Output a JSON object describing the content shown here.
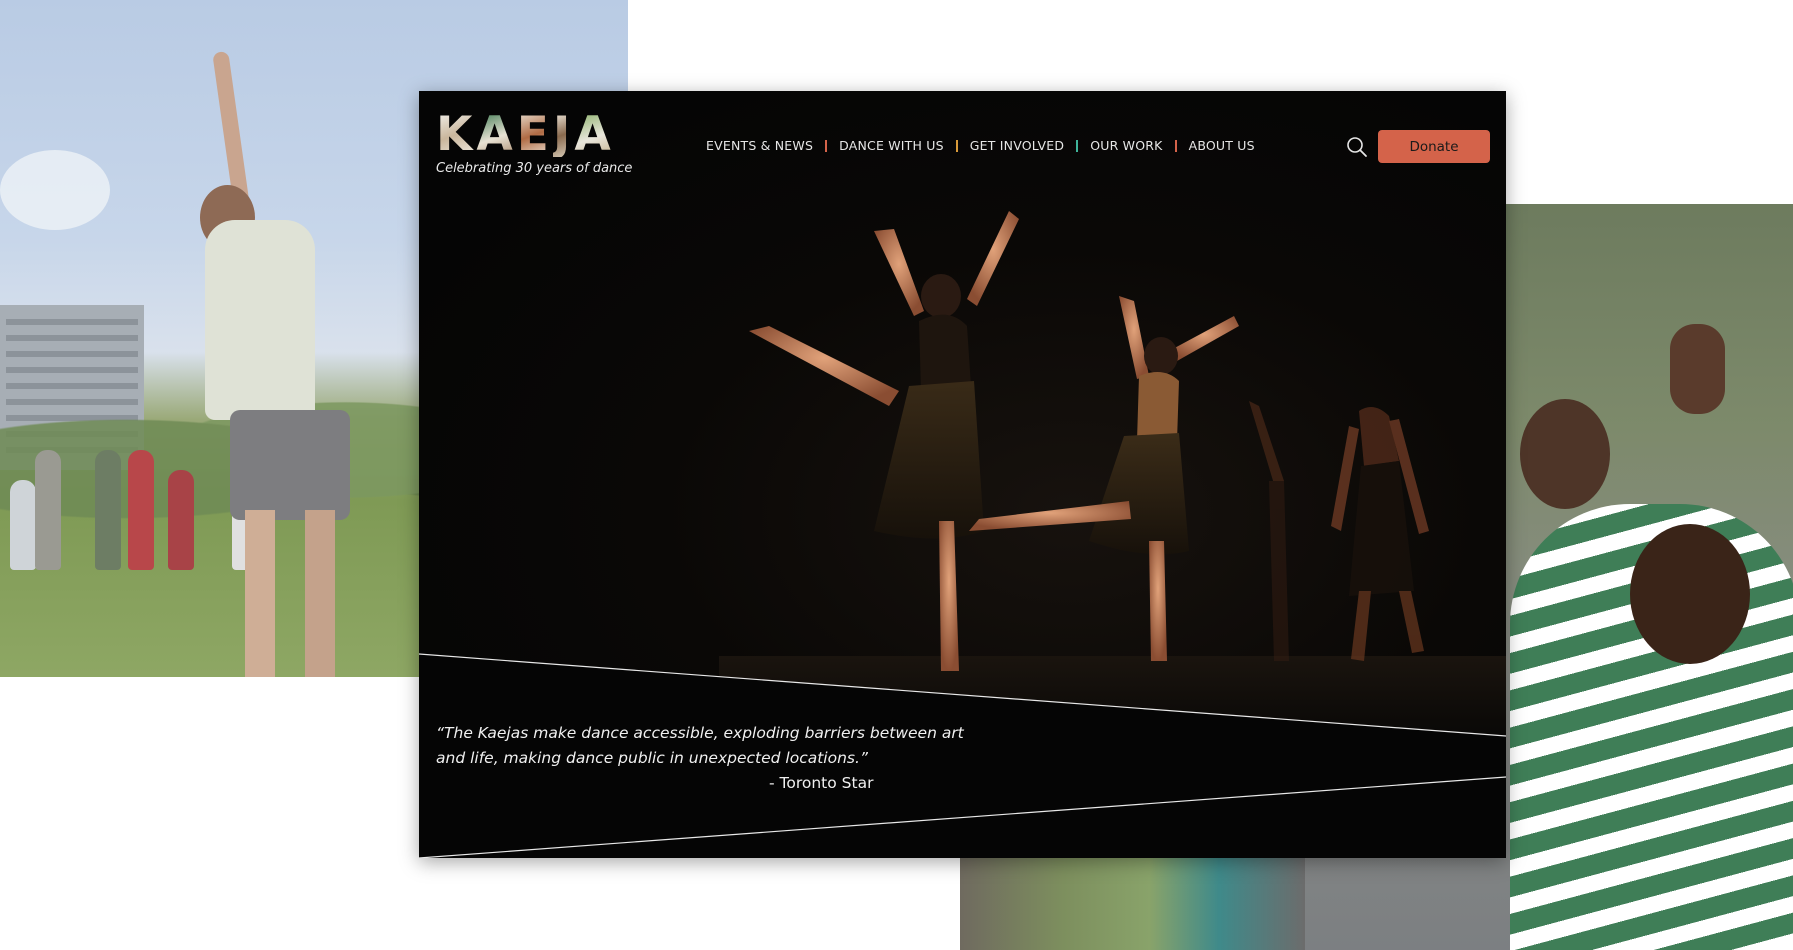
{
  "brand": {
    "logo_letters": [
      "K",
      "A",
      "E",
      "J",
      "A"
    ],
    "tagline": "Celebrating 30 years of dance"
  },
  "nav": {
    "items": [
      {
        "label": "EVENTS & NEWS",
        "sep_color": "#d4634a"
      },
      {
        "label": "DANCE WITH US",
        "sep_color": "#d99a3a"
      },
      {
        "label": "GET INVOLVED",
        "sep_color": "#3fb39a"
      },
      {
        "label": "OUR WORK",
        "sep_color": "#d4634a"
      },
      {
        "label": "ABOUT US",
        "sep_color": ""
      }
    ]
  },
  "header": {
    "search_icon": "search-icon",
    "donate_label": "Donate"
  },
  "hero": {
    "quote": "“The Kaejas make dance accessible, exploding barriers between art and life, making dance public in unexpected locations.”",
    "attribution": "- Toronto Star"
  },
  "colors": {
    "accent": "#d4634a",
    "background": "#050505",
    "text": "#f0f0f0"
  }
}
